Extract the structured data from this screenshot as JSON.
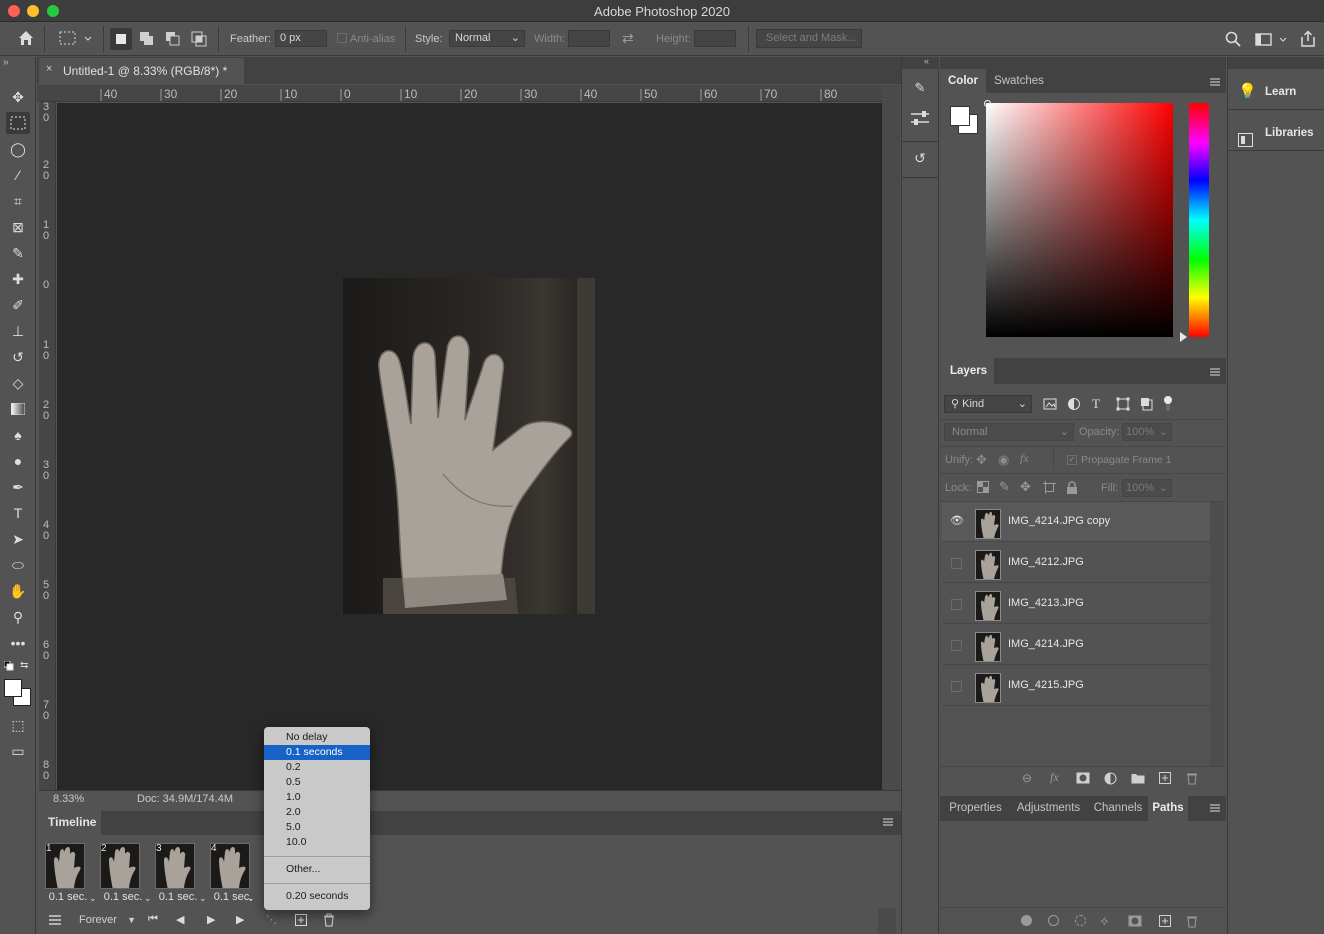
{
  "app": {
    "title": "Adobe Photoshop 2020"
  },
  "options": {
    "feather_label": "Feather:",
    "feather_value": "0 px",
    "antialias_label": "Anti-alias",
    "style_label": "Style:",
    "style_value": "Normal",
    "width_label": "Width:",
    "height_label": "Height:",
    "select_mask_label": "Select and Mask..."
  },
  "document": {
    "tab_title": "Untitled-1 @ 8.33% (RGB/8*) *",
    "zoom": "8.33%",
    "doc_size": "Doc: 34.9M/174.4M",
    "ruler_h": [
      "40",
      "30",
      "20",
      "10",
      "0",
      "10",
      "20",
      "30",
      "40",
      "50",
      "60",
      "70",
      "80"
    ],
    "ruler_v": [
      "3\n0",
      "2\n0",
      "1\n0",
      "0",
      "1\n0",
      "2\n0",
      "3\n0",
      "4\n0",
      "5\n0",
      "6\n0",
      "7\n0",
      "8\n0"
    ]
  },
  "timeline": {
    "title": "Timeline",
    "frames": [
      {
        "num": "1",
        "delay": "0.1 sec."
      },
      {
        "num": "2",
        "delay": "0.1 sec."
      },
      {
        "num": "3",
        "delay": "0.1 sec."
      },
      {
        "num": "4",
        "delay": "0.1 sec."
      }
    ],
    "loop": "Forever"
  },
  "delay_menu": {
    "items": [
      "No delay",
      "0.1 seconds",
      "0.2",
      "0.5",
      "1.0",
      "2.0",
      "5.0",
      "10.0"
    ],
    "selected": "0.1 seconds",
    "other": "Other...",
    "recent": "0.20 seconds"
  },
  "color_panel": {
    "tabs": [
      "Color",
      "Swatches"
    ],
    "active_tab": "Color"
  },
  "layers_panel": {
    "title": "Layers",
    "kind_label": "Kind",
    "blend_mode": "Normal",
    "opacity_label": "Opacity:",
    "opacity_value": "100%",
    "unify_label": "Unify:",
    "propagate_label": "Propagate Frame 1",
    "lock_label": "Lock:",
    "fill_label": "Fill:",
    "fill_value": "100%",
    "layers": [
      {
        "name": "IMG_4214.JPG copy",
        "visible": true
      },
      {
        "name": "IMG_4212.JPG",
        "visible": false
      },
      {
        "name": "IMG_4213.JPG",
        "visible": false
      },
      {
        "name": "IMG_4214.JPG",
        "visible": false
      },
      {
        "name": "IMG_4215.JPG",
        "visible": false
      }
    ]
  },
  "bottom_panel": {
    "tabs": [
      "Properties",
      "Adjustments",
      "Channels",
      "Paths"
    ],
    "active_tab": "Paths"
  },
  "right_column": {
    "learn": "Learn",
    "libraries": "Libraries"
  },
  "colors": {
    "menu_highlight": "#1762c6",
    "panel_bg": "#535353",
    "canvas_bg": "#282828"
  }
}
